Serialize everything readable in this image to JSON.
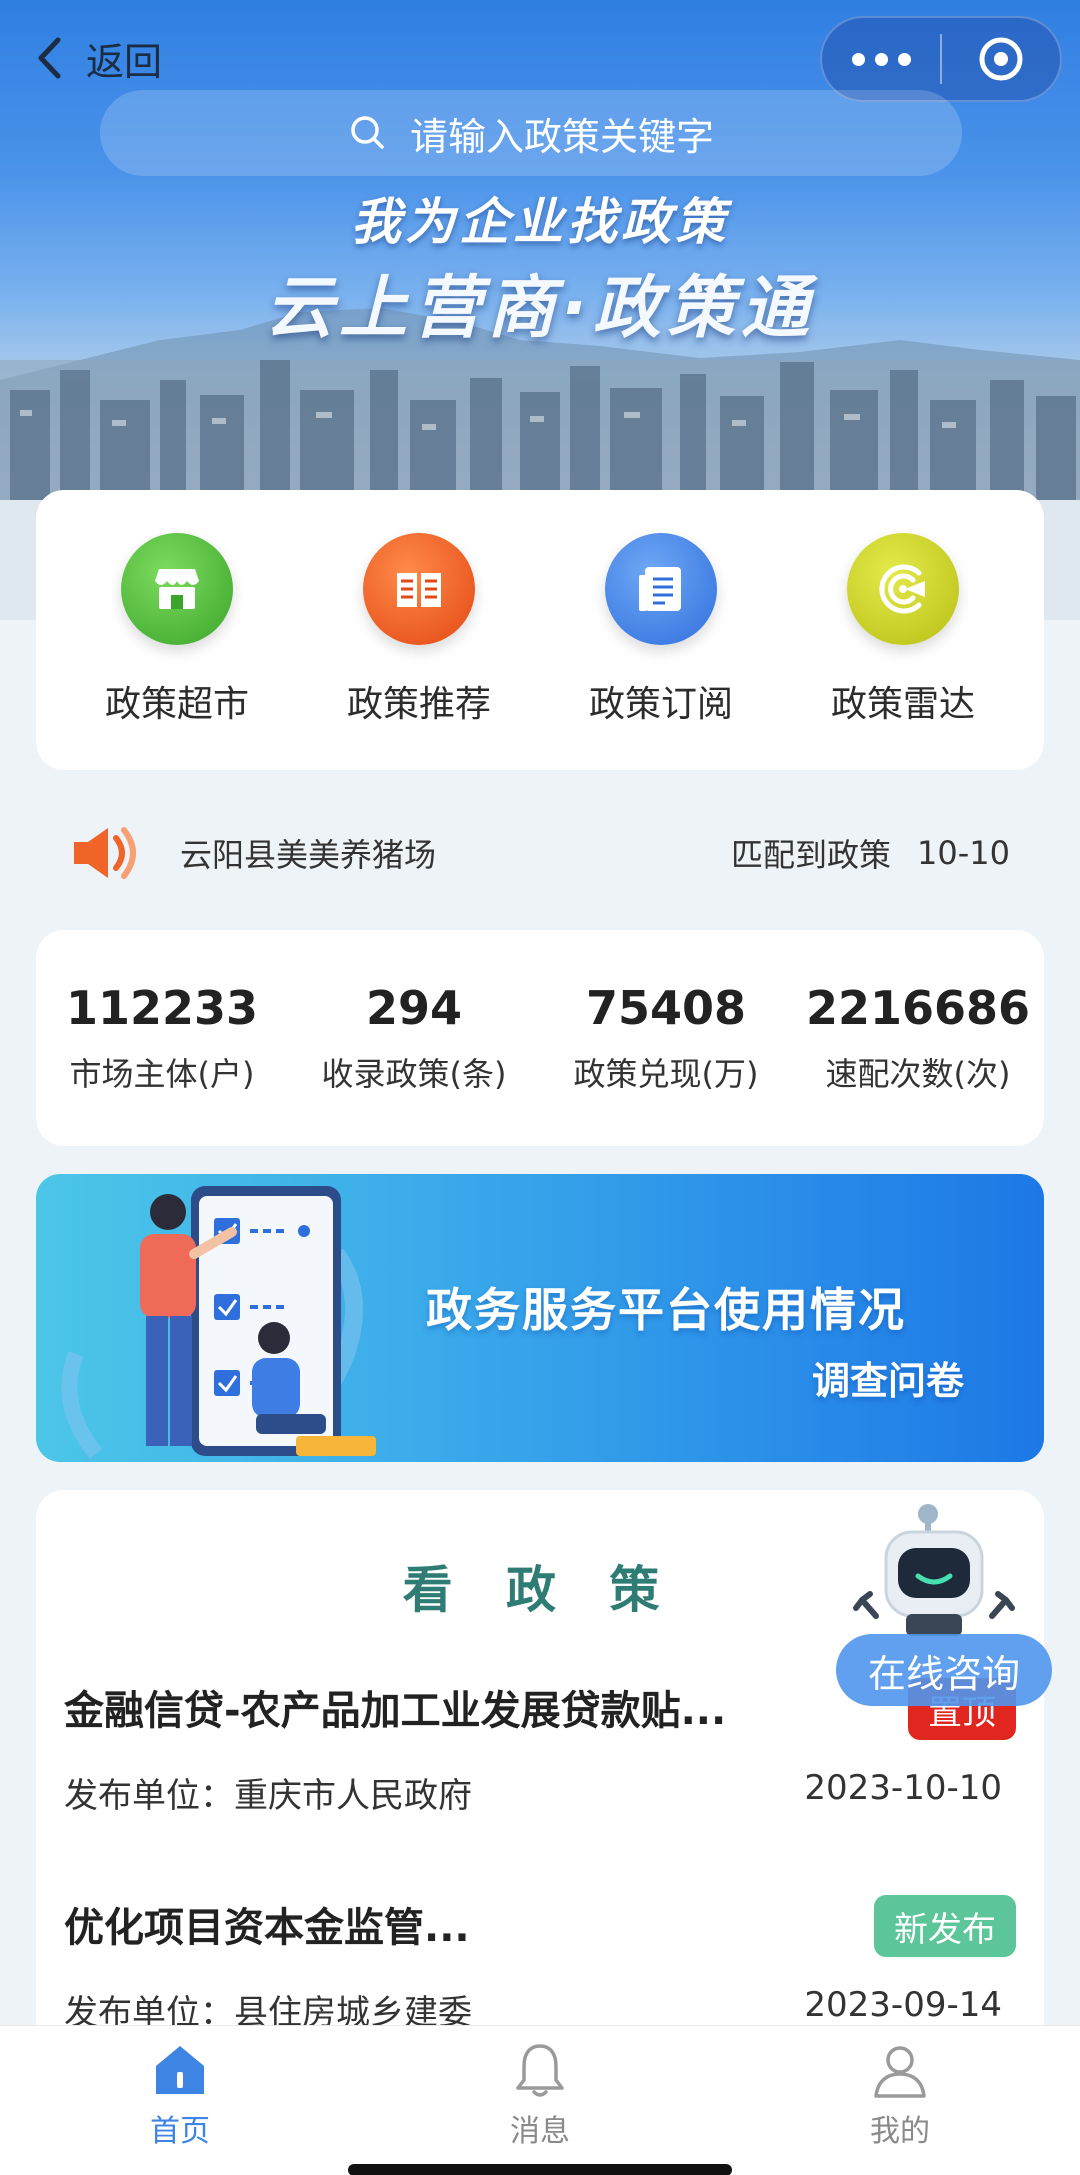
{
  "nav": {
    "back_label": "返回"
  },
  "search": {
    "placeholder": "请输入政策关键字"
  },
  "hero": {
    "slogan_top": "我为企业找政策",
    "slogan_main": "云上营商·政策通"
  },
  "quick": {
    "items": [
      {
        "label": "政策超市",
        "icon": "store-icon",
        "color": "#4cbc3a"
      },
      {
        "label": "政策推荐",
        "icon": "book-icon",
        "color": "#f0581c"
      },
      {
        "label": "政策订阅",
        "icon": "document-icon",
        "color": "#3f82e6"
      },
      {
        "label": "政策雷达",
        "icon": "radar-icon",
        "color": "#c9d21c"
      }
    ]
  },
  "notice": {
    "company": "云阳县美美养猪场",
    "match_text": "匹配到政策",
    "date": "10-10"
  },
  "stats": [
    {
      "value": "112233",
      "label": "市场主体(户)"
    },
    {
      "value": "294",
      "label": "收录政策(条)"
    },
    {
      "value": "75408",
      "label": "政策兑现(万)"
    },
    {
      "value": "2216686",
      "label": "速配次数(次)"
    }
  ],
  "survey": {
    "title": "政务服务平台使用情况",
    "subtitle": "调查问卷"
  },
  "policies": {
    "title": "看 政 策",
    "items": [
      {
        "name": "金融信贷-农产品加工业发展贷款贴...",
        "tag": "置顶",
        "tag_color": "#e0261f",
        "publisher": "发布单位：重庆市人民政府",
        "date": "2023-10-10"
      },
      {
        "name": "优化项目资本金监管...",
        "tag": "新发布",
        "tag_color": "#5cc59a",
        "publisher": "发布单位：县住房城乡建委",
        "date": "2023-09-14"
      }
    ]
  },
  "consult": {
    "label": "在线咨询"
  },
  "tabbar": {
    "items": [
      {
        "label": "首页",
        "active": true
      },
      {
        "label": "消息",
        "active": false
      },
      {
        "label": "我的",
        "active": false
      }
    ]
  }
}
